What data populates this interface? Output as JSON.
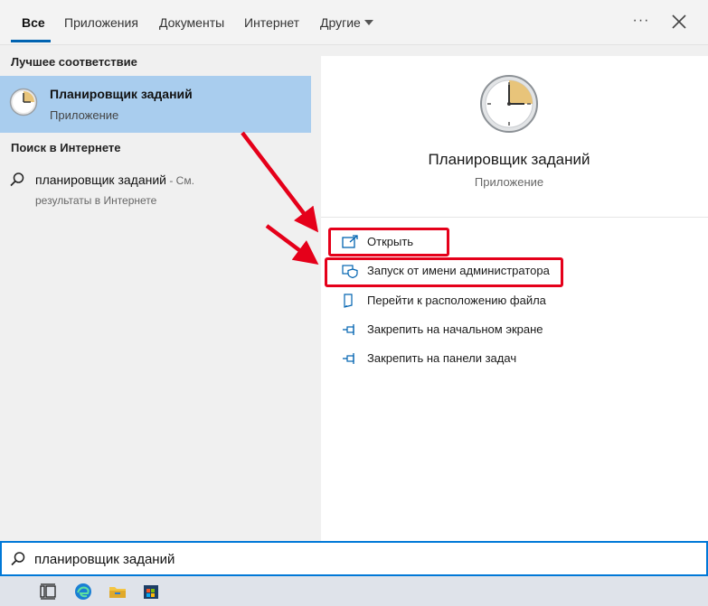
{
  "tabs": {
    "all": "Все",
    "apps": "Приложения",
    "documents": "Документы",
    "internet": "Интернет",
    "other": "Другие",
    "more": "···"
  },
  "left": {
    "best_match_title": "Лучшее соответствие",
    "best_match": {
      "name": "Планировщик заданий",
      "type": "Приложение"
    },
    "web_title": "Поиск в Интернете",
    "web_item": {
      "query": "планировщик заданий",
      "suffix": " - См.",
      "sub": "результаты в Интернете"
    }
  },
  "detail": {
    "name": "Планировщик заданий",
    "type": "Приложение",
    "actions": [
      {
        "label": "Открыть",
        "icon": "open-icon"
      },
      {
        "label": "Запуск от имени администратора",
        "icon": "shield-icon"
      },
      {
        "label": "Перейти к расположению файла",
        "icon": "file-location-icon"
      },
      {
        "label": "Закрепить на начальном экране",
        "icon": "pin-icon"
      },
      {
        "label": "Закрепить на панели задач",
        "icon": "pin-icon"
      }
    ]
  },
  "search": {
    "value": "планировщик заданий"
  },
  "colors": {
    "accent": "#0078d7",
    "selection": "#a9cdee",
    "highlight": "#e5001a"
  },
  "taskbar": {
    "icons": [
      "task-view-icon",
      "edge-icon",
      "file-explorer-icon",
      "store-icon"
    ]
  }
}
